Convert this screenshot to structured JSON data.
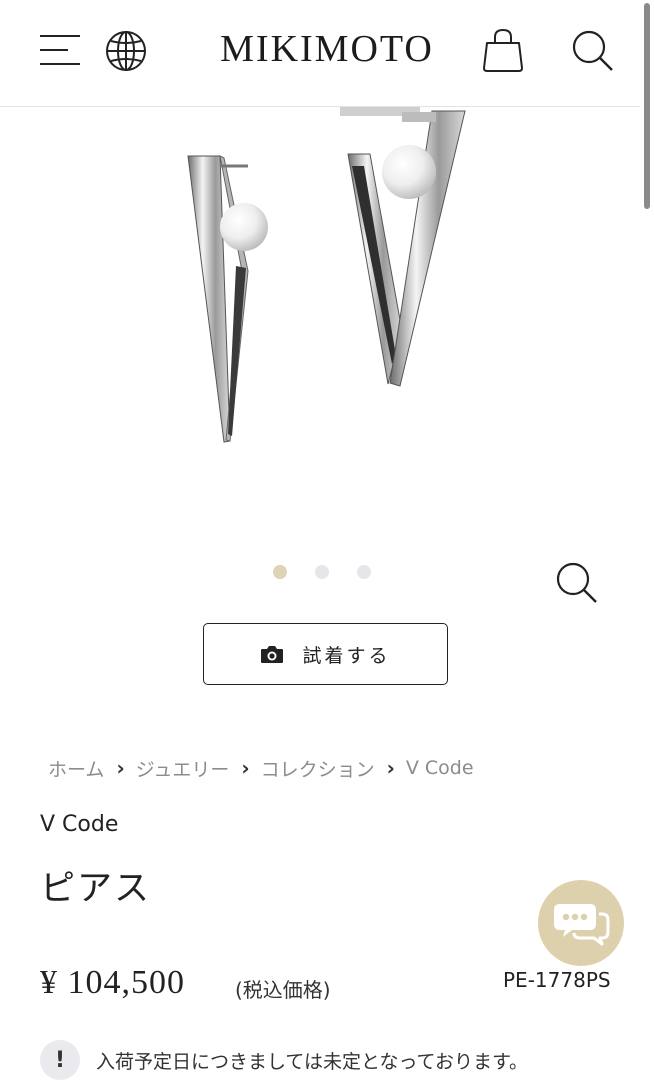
{
  "header": {
    "logo": "MIKIMOTO",
    "icons": {
      "menu": "hamburger-menu-icon",
      "language": "globe-icon",
      "cart": "shopping-bag-icon",
      "search": "search-icon"
    }
  },
  "gallery": {
    "image": "product-photo-v-shaped-pearl-earrings",
    "slide_count": 3,
    "active_slide": 1,
    "zoom_icon": "zoom-icon",
    "colors": {
      "active_dot": "#ded3b6",
      "inactive_dot": "#e6e6ea"
    }
  },
  "try_on": {
    "label": "試着する",
    "icon": "camera-icon"
  },
  "breadcrumb": {
    "items": [
      "ホーム",
      "ジュエリー",
      "コレクション",
      "V Code"
    ],
    "separator": "›"
  },
  "product": {
    "collection": "V Code",
    "title": "ピアス",
    "price": "¥ 104,500",
    "tax_note": "(税込価格)",
    "code": "PE-1778PS"
  },
  "chat": {
    "icon": "chat-bubbles-icon",
    "color": "#ddd0ad"
  },
  "notice": {
    "icon_glyph": "!",
    "text": "入荷予定日につきましては未定となっております。"
  }
}
